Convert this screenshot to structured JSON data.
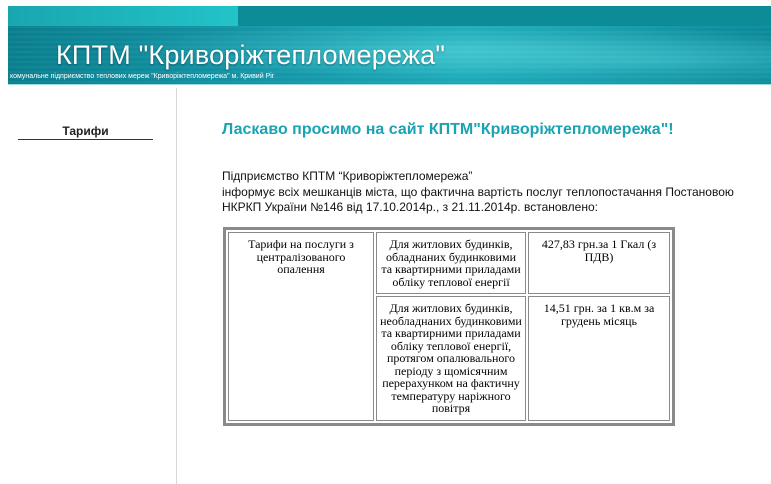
{
  "header": {
    "title": "КПТМ \"Криворіжтепломережа\"",
    "subtitle": "комунальне підприємство теплових мереж \"Криворіжтепломережа\" м. Кривий Ріг"
  },
  "sidebar": {
    "items": [
      {
        "label": "Тарифи"
      }
    ]
  },
  "main": {
    "welcome": "Ласкаво просимо на сайт КПТМ\"Криворіжтепломережа\"!",
    "intro_line1": "Підприємство КПТМ “Криворіжтепломережа”",
    "intro_line2": "інформує всіх мешканців міста, що фактична вартість послуг теплопостачання Постановою НКРКП України №146 від 17.10.2014р., з 21.11.2014р. встановлено:"
  },
  "table": {
    "service": "Тарифи на послуги з централізованого опалення",
    "rows": [
      {
        "category": "Для житлових будинків, обладнаних будинковими та квартирними приладами обліку теплової енергії",
        "price": "427,83 грн.за 1 Гкал (з ПДВ)"
      },
      {
        "category": "Для житлових будинків, необладнаних будинковими та квартирними приладами обліку теплової енергії, протягом опалювального періоду з щомісячним перерахунком на фактичну температуру наріжного повітря",
        "price": "14,51 грн. за 1 кв.м за грудень місяць"
      }
    ]
  },
  "colors": {
    "accent": "#1aa3b2",
    "banner": "#0c8c97"
  }
}
